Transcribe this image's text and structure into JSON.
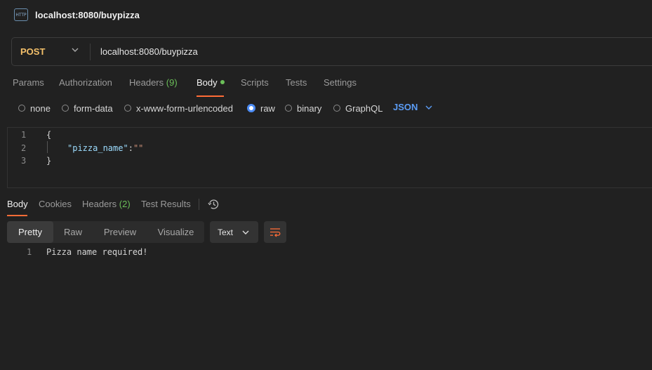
{
  "tab": {
    "icon": "http-icon",
    "icon_text": "HTTP",
    "title": "localhost:8080/buypizza"
  },
  "request": {
    "method": "POST",
    "url": "localhost:8080/buypizza"
  },
  "request_tabs": [
    {
      "label": "Params"
    },
    {
      "label": "Authorization"
    },
    {
      "label": "Headers",
      "count": "(9)"
    },
    {
      "label": "Body",
      "active": true
    },
    {
      "label": "Scripts"
    },
    {
      "label": "Tests"
    },
    {
      "label": "Settings"
    }
  ],
  "body_types": [
    "none",
    "form-data",
    "x-www-form-urlencoded",
    "raw",
    "binary",
    "GraphQL"
  ],
  "body_type_selected": "raw",
  "raw_format": "JSON",
  "editor": {
    "line_numbers": [
      "1",
      "2",
      "3"
    ],
    "open_brace": "{",
    "key": "\"pizza_name\"",
    "colon": ":",
    "value": "\"\"",
    "close_brace": "}"
  },
  "response_tabs": [
    {
      "label": "Body",
      "active": true
    },
    {
      "label": "Cookies"
    },
    {
      "label": "Headers",
      "count": "(2)"
    },
    {
      "label": "Test Results"
    }
  ],
  "view_modes": [
    "Pretty",
    "Raw",
    "Preview",
    "Visualize"
  ],
  "view_mode_selected": "Pretty",
  "response_format": "Text",
  "response": {
    "line_number": "1",
    "text": "Pizza name required!"
  },
  "colors": {
    "accent": "#ff6c37",
    "method": "#f4c06a",
    "link": "#5b9cf5",
    "success": "#6bbf59"
  }
}
